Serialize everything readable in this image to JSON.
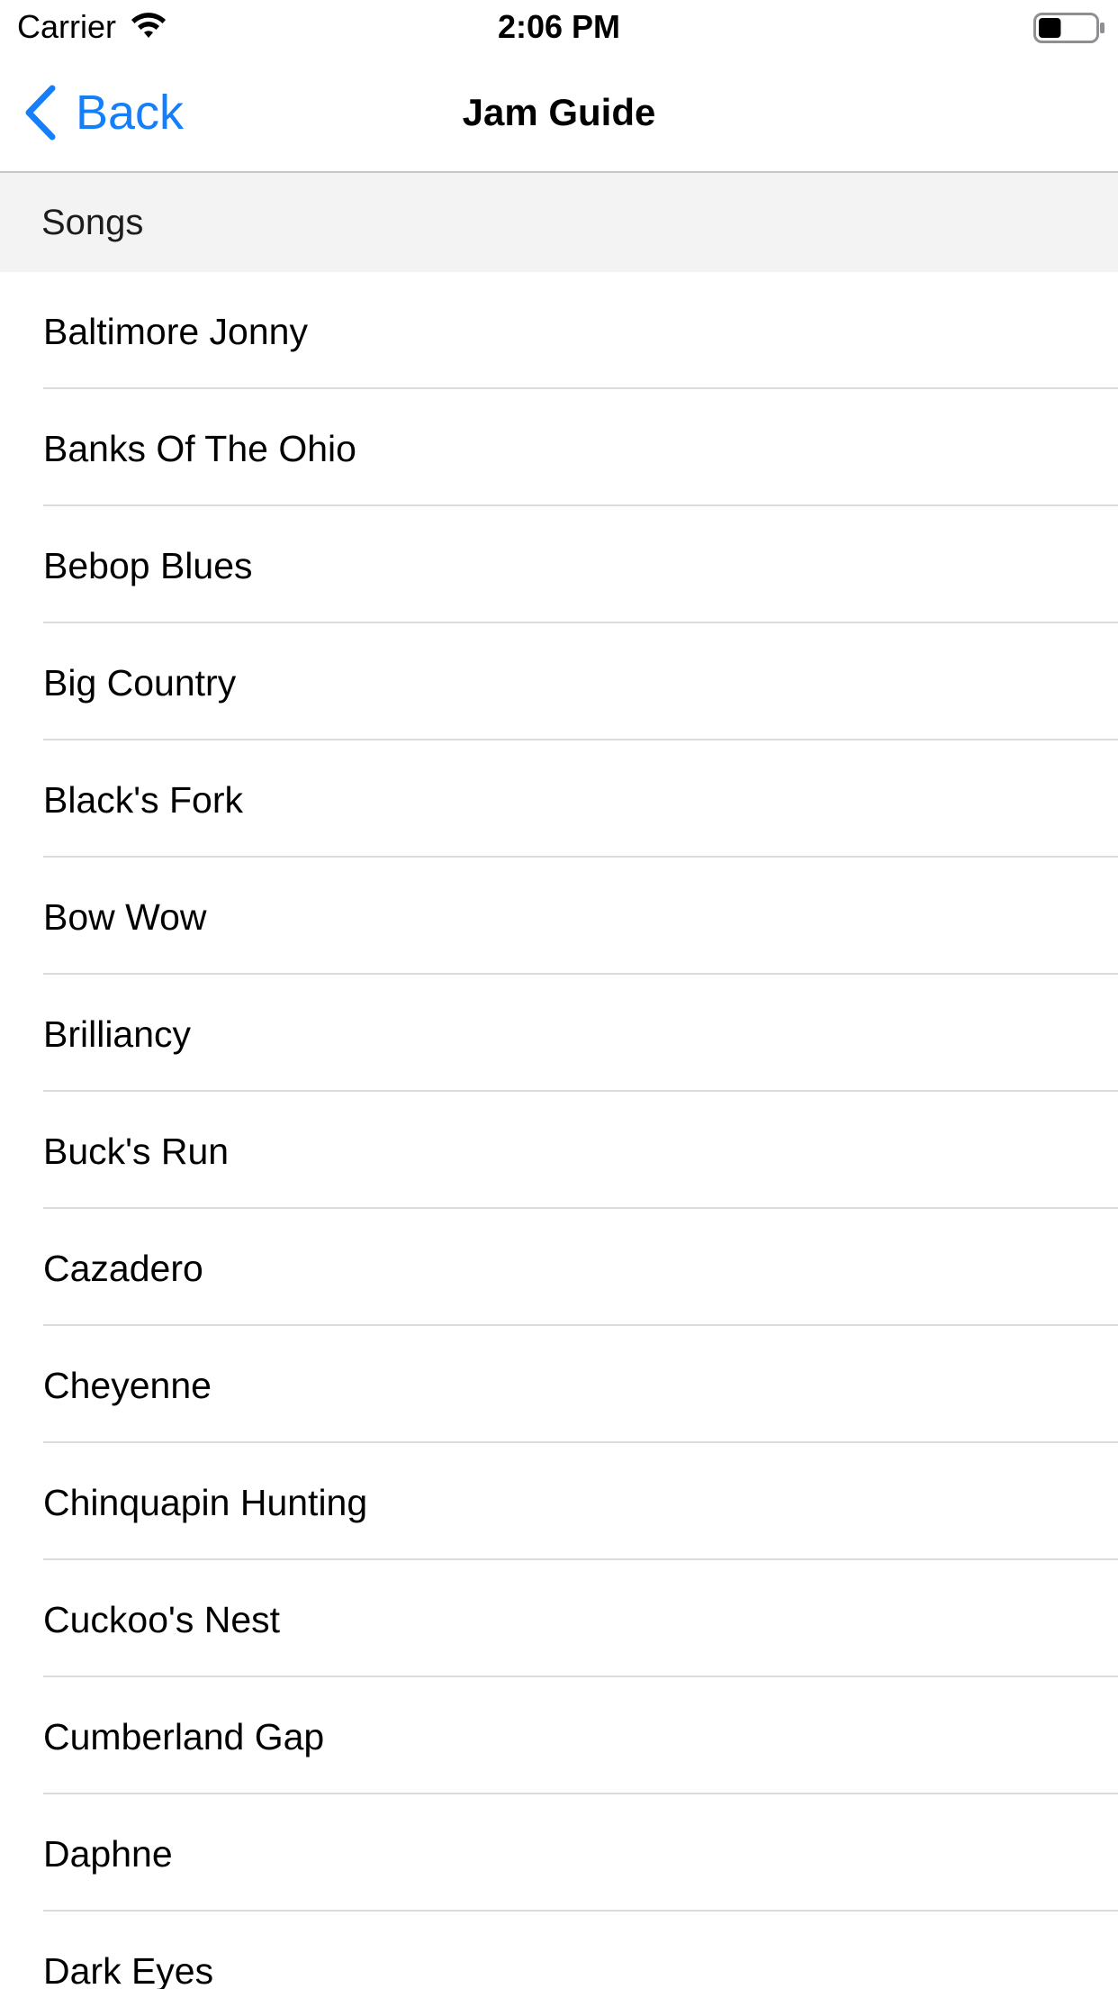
{
  "status_bar": {
    "carrier": "Carrier",
    "time": "2:06 PM",
    "wifi_icon": "wifi-icon",
    "battery_icon": "battery-icon",
    "battery_level": 0.4
  },
  "nav": {
    "back_label": "Back",
    "back_icon": "chevron-left-icon",
    "title": "Jam Guide",
    "accent_color": "#147efb"
  },
  "section": {
    "header": "Songs"
  },
  "songs": [
    "Baltimore Jonny",
    "Banks Of The Ohio",
    "Bebop Blues",
    "Big Country",
    "Black's Fork",
    "Bow Wow",
    "Brilliancy",
    "Buck's Run",
    "Cazadero",
    "Cheyenne",
    "Chinquapin Hunting",
    "Cuckoo's Nest",
    "Cumberland Gap",
    "Daphne",
    "Dark Eyes"
  ]
}
